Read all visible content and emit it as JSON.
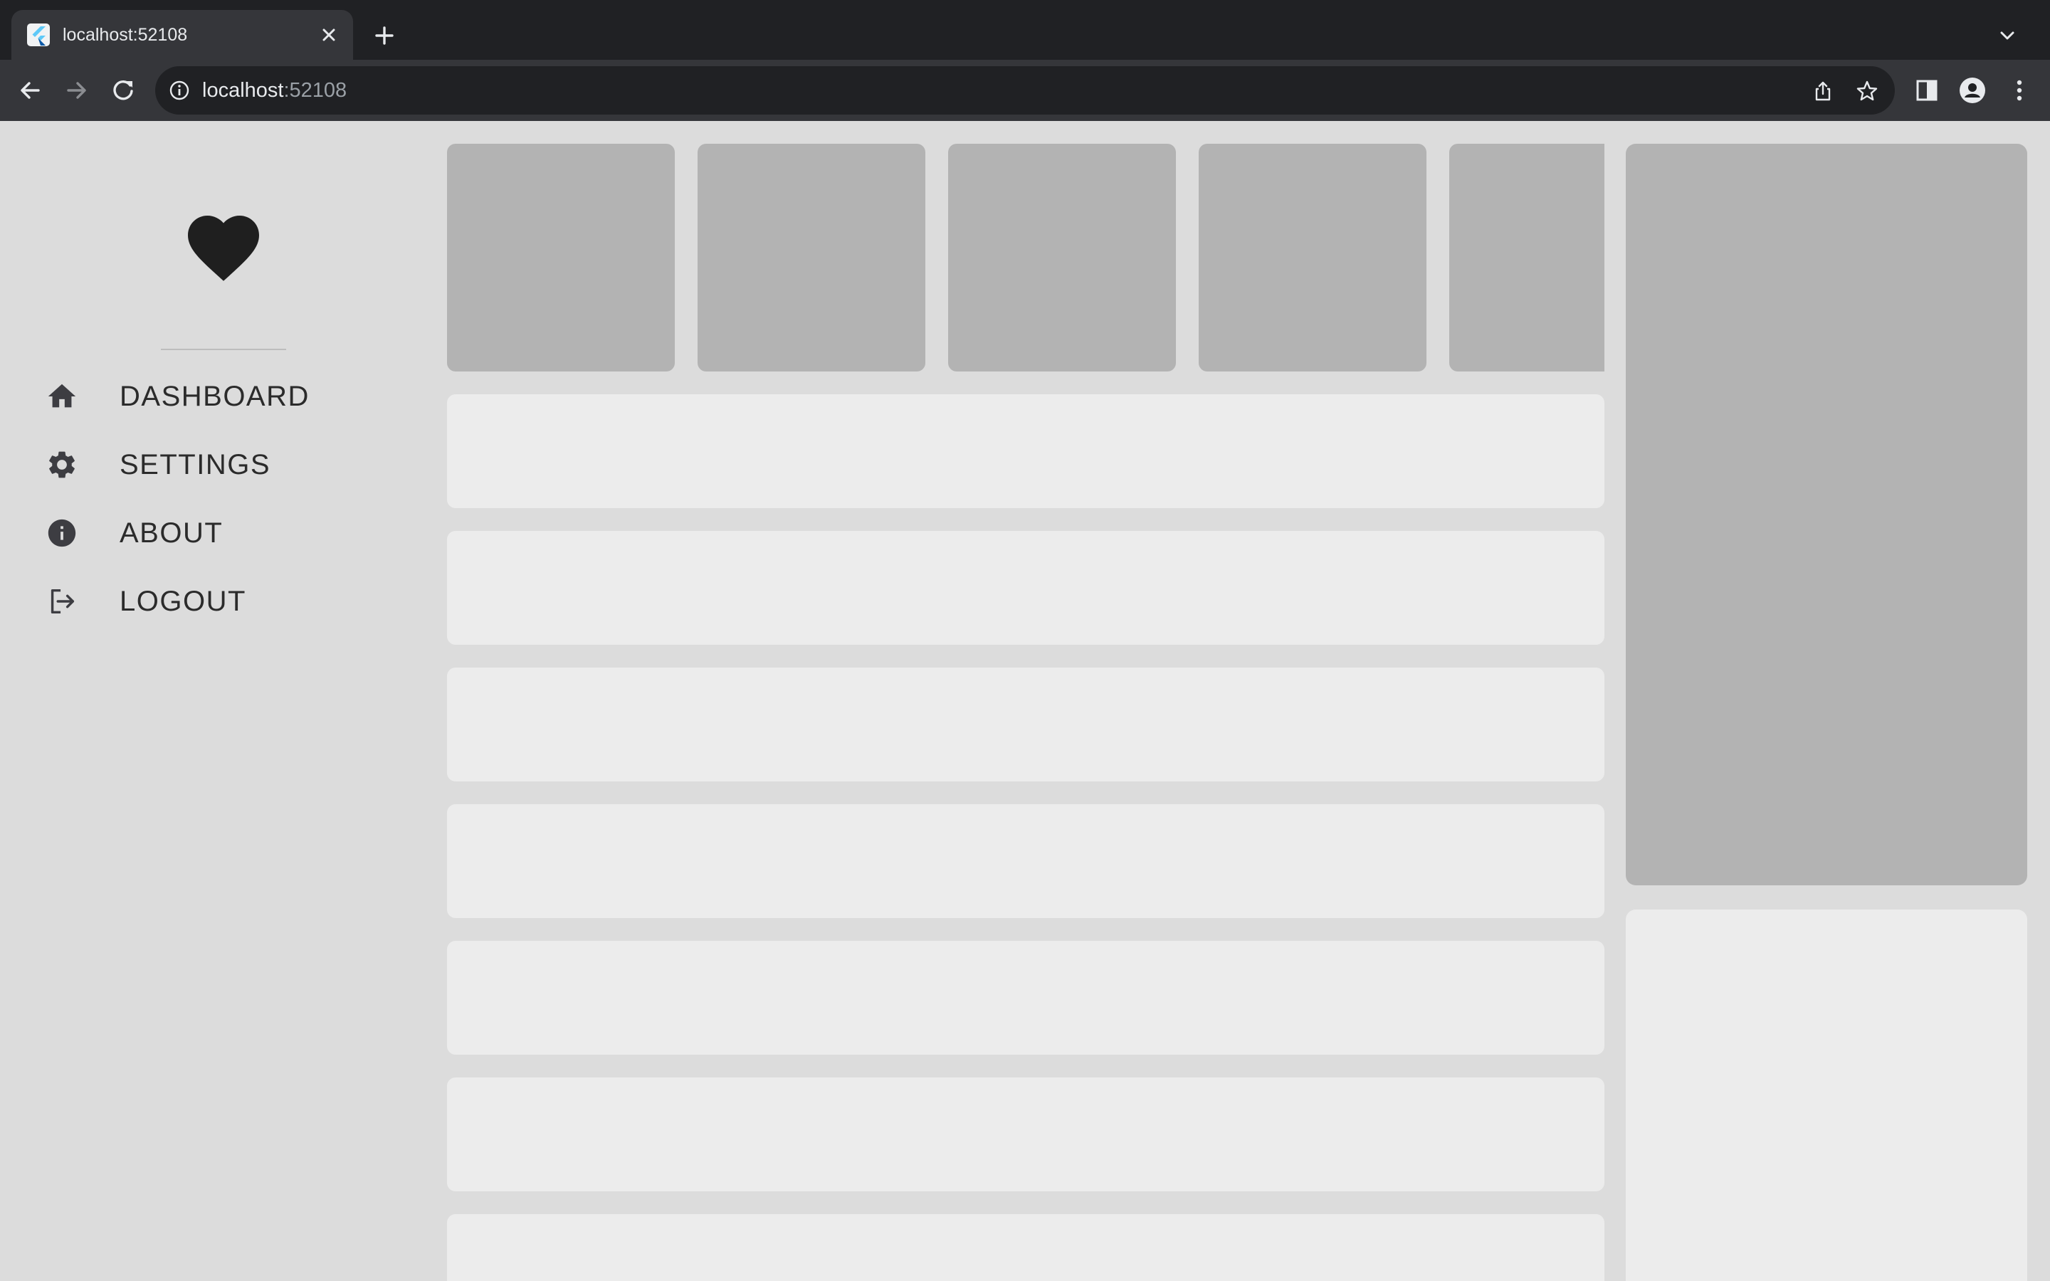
{
  "browser": {
    "tab": {
      "title": "localhost:52108"
    },
    "address": {
      "host": "localhost",
      "port": ":52108"
    },
    "icons": {
      "back": "arrow-left-icon",
      "forward": "arrow-right-icon",
      "reload": "reload-icon",
      "site_info": "info-icon",
      "share": "share-icon",
      "bookmark": "star-icon",
      "side_panel": "side-panel-icon",
      "profile": "profile-icon",
      "menu": "kebab-menu-icon",
      "close_tab": "close-icon",
      "new_tab": "plus-icon",
      "tab_search": "chevron-down-icon"
    },
    "colors": {
      "frame": "#202124",
      "toolbar": "#35363a",
      "text": "#e8eaed",
      "muted": "#9aa0a6"
    }
  },
  "app": {
    "logo_icon": "heart-icon",
    "nav": [
      {
        "label": "DASHBOARD",
        "icon": "home-icon"
      },
      {
        "label": "SETTINGS",
        "icon": "gear-icon"
      },
      {
        "label": "ABOUT",
        "icon": "info-icon"
      },
      {
        "label": "LOGOUT",
        "icon": "logout-icon"
      }
    ],
    "colors": {
      "background": "#dcdcdc",
      "placeholder_dark": "#b3b3b3",
      "placeholder_light": "#ececec",
      "nav_text": "#2b2b2b",
      "nav_icon": "#3d3d42"
    }
  }
}
